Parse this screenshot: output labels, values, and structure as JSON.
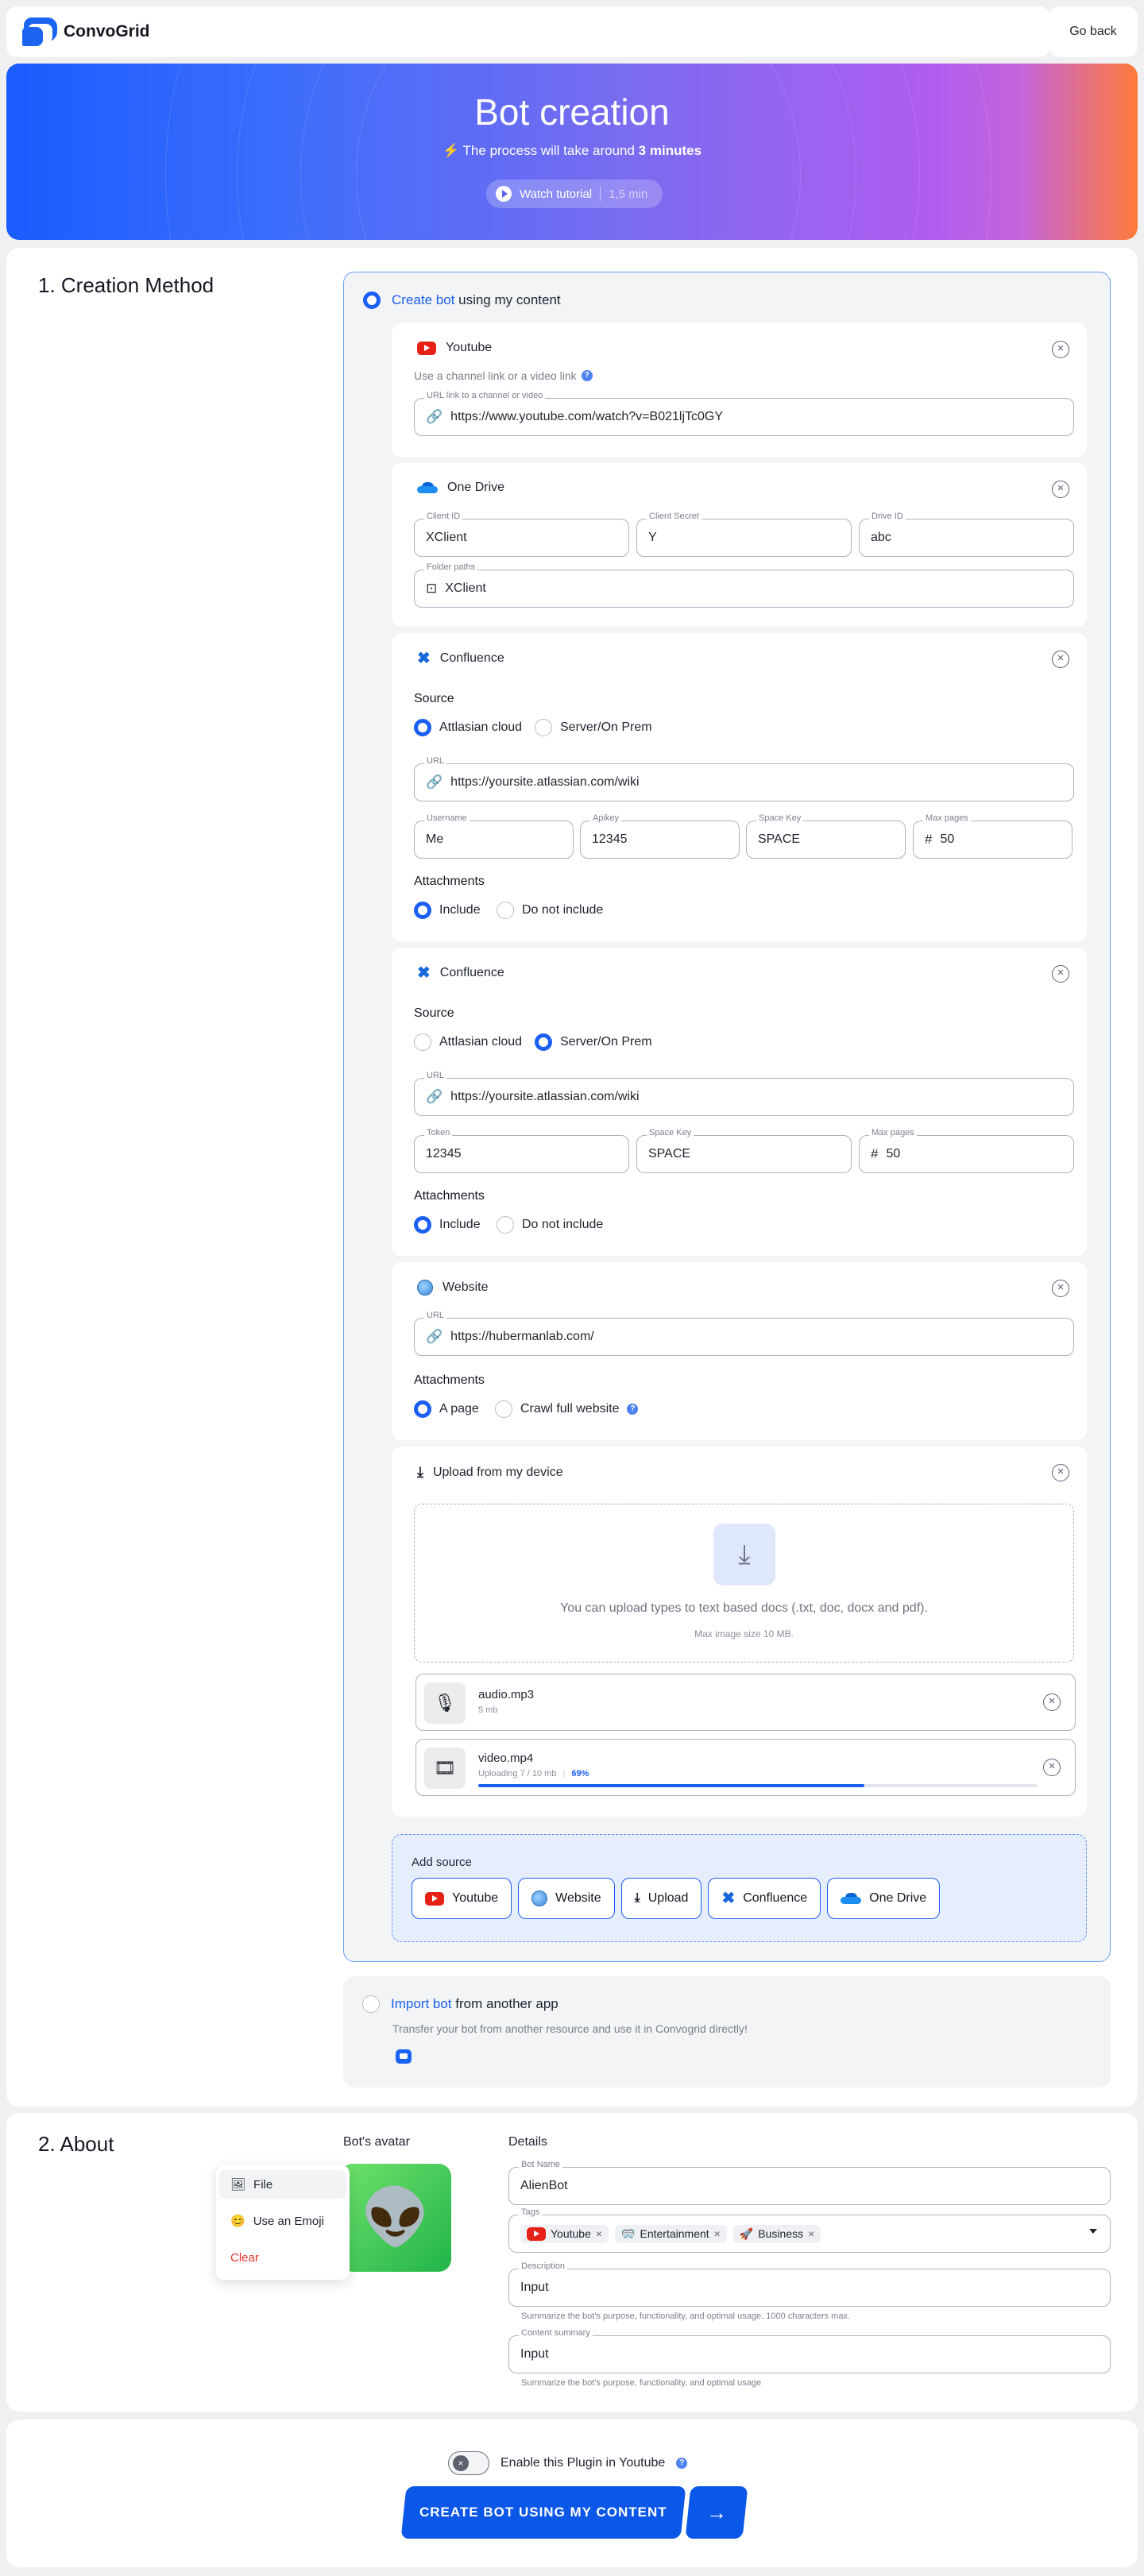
{
  "header": {
    "brand": "ConvoGrid",
    "go_back": "Go back"
  },
  "hero": {
    "title": "Bot creation",
    "subtitle_prefix": "The process will take around",
    "subtitle_bold": "3 minutes",
    "tutorial_label": "Watch tutorial",
    "tutorial_duration": "1,5 min"
  },
  "creation": {
    "section_title": "1. Creation Method",
    "create_link": "Create bot",
    "create_rest": "using my content",
    "youtube": {
      "title": "Youtube",
      "hint": "Use a channel link or a video link",
      "url_label": "URL link to a channel or video",
      "url_value": "https://www.youtube.com/watch?v=B021ljTc0GY"
    },
    "onedrive": {
      "title": "One Drive",
      "client_id_label": "Client ID",
      "client_id": "XClient",
      "client_secret_label": "Client Secret",
      "client_secret": "Y",
      "drive_id_label": "Drive ID",
      "drive_id": "abc",
      "folder_label": "Folder paths",
      "folder_value": "XClient"
    },
    "confluence1": {
      "title": "Confluence",
      "source_label": "Source",
      "opt_cloud": "Attlasian cloud",
      "opt_server": "Server/On Prem",
      "url_label": "URL",
      "url_value": "https://yoursite.atlassian.com/wiki",
      "username_label": "Username",
      "username": "Me",
      "apikey_label": "Apikey",
      "apikey": "12345",
      "spacekey_label": "Space Key",
      "spacekey": "SPACE",
      "maxpages_label": "Max pages",
      "maxpages": "50",
      "attach_label": "Attachments",
      "opt_include": "Include",
      "opt_exclude": "Do not include"
    },
    "confluence2": {
      "title": "Confluence",
      "source_label": "Source",
      "opt_cloud": "Attlasian cloud",
      "opt_server": "Server/On Prem",
      "url_label": "URL",
      "url_value": "https://yoursite.atlassian.com/wiki",
      "token_label": "Token",
      "token": "12345",
      "spacekey_label": "Space Key",
      "spacekey": "SPACE",
      "maxpages_label": "Max pages",
      "maxpages": "50",
      "attach_label": "Attachments",
      "opt_include": "Include",
      "opt_exclude": "Do not include"
    },
    "website": {
      "title": "Website",
      "url_label": "URL",
      "url_value": "https://hubermanlab.com/",
      "attach_label": "Attachments",
      "opt_page": "A page",
      "opt_crawl": "Crawl full website"
    },
    "upload": {
      "title": "Upload from my device",
      "drop_text": "You can upload types to text based docs (.txt, doc, docx and pdf).",
      "drop_sub": "Max image size 10 MB.",
      "files": [
        {
          "name": "audio.mp3",
          "meta": "5 mb"
        },
        {
          "name": "video.mp4",
          "meta": "Uploading 7 / 10 mb",
          "percent": "69%",
          "progress": 0.69
        }
      ]
    },
    "add_source": {
      "label": "Add source",
      "buttons": [
        "Youtube",
        "Website",
        "Upload",
        "Confluence",
        "One Drive"
      ]
    },
    "import": {
      "link": "Import bot",
      "rest": "from another app",
      "desc": "Transfer your bot from another resource and use it in Convogrid directly!"
    }
  },
  "about": {
    "section_title": "2. About",
    "avatar_label": "Bot's avatar",
    "menu": {
      "file": "File",
      "emoji": "Use an Emoji",
      "clear": "Clear"
    },
    "details_label": "Details",
    "name_label": "Bot Name",
    "name_value": "AlienBot",
    "tags_label": "Tags",
    "tags": [
      "Youtube",
      "Entertainment",
      "Business"
    ],
    "desc_label": "Description",
    "desc_value": "Input",
    "desc_help": "Summarize the bot's purpose, functionality, and optimal usage. 1000 characters max.",
    "summary_label": "Content summary",
    "summary_value": "Input",
    "summary_help": "Summarize the bot's purpose, functionality, and optimal usage"
  },
  "footer": {
    "toggle_label": "Enable this Plugin in Youtube",
    "create_button": "CREATE BOT USING MY CONTENT"
  },
  "colors": {
    "accent": "#1b5ff3",
    "button": "#0b57e8",
    "add_source_bg": "#e6eefe"
  }
}
